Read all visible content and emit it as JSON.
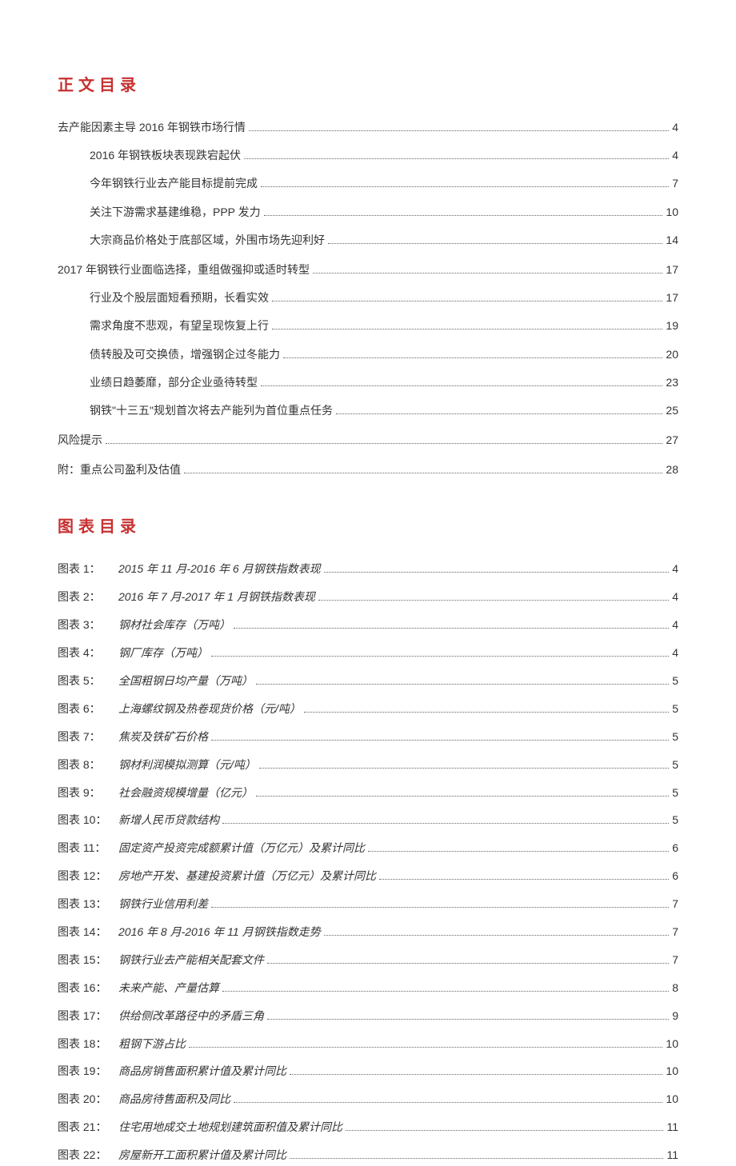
{
  "headings": {
    "toc": "正文目录",
    "figures": "图表目录"
  },
  "toc": [
    {
      "level": 1,
      "text": "去产能因素主导 2016 年钢铁市场行情",
      "page": "4"
    },
    {
      "level": 2,
      "text": "2016 年钢铁板块表现跌宕起伏",
      "page": "4"
    },
    {
      "level": 2,
      "text": "今年钢铁行业去产能目标提前完成",
      "page": "7"
    },
    {
      "level": 2,
      "text": "关注下游需求基建维稳，PPP 发力",
      "page": "10"
    },
    {
      "level": 2,
      "text": "大宗商品价格处于底部区域，外围市场先迎利好",
      "page": "14"
    },
    {
      "level": 1,
      "text": "2017 年钢铁行业面临选择，重组做强抑或适时转型",
      "page": "17"
    },
    {
      "level": 2,
      "text": "行业及个股层面短看预期，长看实效",
      "page": "17"
    },
    {
      "level": 2,
      "text": "需求角度不悲观，有望呈现恢复上行",
      "page": "19"
    },
    {
      "level": 2,
      "text": "债转股及可交换债，增强钢企过冬能力",
      "page": "20"
    },
    {
      "level": 2,
      "text": "业绩日趋萎靡，部分企业亟待转型",
      "page": "23"
    },
    {
      "level": 2,
      "text": "钢铁\"十三五\"规划首次将去产能列为首位重点任务",
      "page": "25"
    },
    {
      "level": 1,
      "text": "风险提示",
      "page": "27"
    },
    {
      "level": 1,
      "text": "附：重点公司盈利及估值",
      "page": "28"
    }
  ],
  "figures": [
    {
      "label": "图表 1：",
      "title": "2015 年 11 月-2016 年 6 月钢铁指数表现",
      "page": "4"
    },
    {
      "label": "图表 2：",
      "title": "2016 年 7 月-2017 年 1 月钢铁指数表现",
      "page": "4"
    },
    {
      "label": "图表 3：",
      "title": "钢材社会库存（万吨）",
      "page": "4"
    },
    {
      "label": "图表 4：",
      "title": "钢厂库存（万吨）",
      "page": "4"
    },
    {
      "label": "图表 5：",
      "title": "全国粗钢日均产量（万吨）",
      "page": "5"
    },
    {
      "label": "图表 6：",
      "title": "上海螺纹钢及热卷现货价格（元/吨）",
      "page": "5"
    },
    {
      "label": "图表 7：",
      "title": "焦炭及铁矿石价格",
      "page": "5"
    },
    {
      "label": "图表 8：",
      "title": "钢材利润模拟测算（元/吨）",
      "page": "5"
    },
    {
      "label": "图表 9：",
      "title": "社会融资规模增量（亿元）",
      "page": "5"
    },
    {
      "label": "图表 10：",
      "title": "新增人民币贷款结构",
      "page": "5"
    },
    {
      "label": "图表 11：",
      "title": "固定资产投资完成额累计值（万亿元）及累计同比",
      "page": "6"
    },
    {
      "label": "图表 12：",
      "title": "房地产开发、基建投资累计值（万亿元）及累计同比",
      "page": "6"
    },
    {
      "label": "图表 13：",
      "title": "钢铁行业信用利差",
      "page": "7"
    },
    {
      "label": "图表 14：",
      "title": "2016 年 8 月-2016 年 11 月钢铁指数走势",
      "page": "7"
    },
    {
      "label": "图表 15：",
      "title": "钢铁行业去产能相关配套文件",
      "page": "7"
    },
    {
      "label": "图表 16：",
      "title": "未来产能、产量估算",
      "page": "8"
    },
    {
      "label": "图表 17：",
      "title": "供给侧改革路径中的矛盾三角",
      "page": "9"
    },
    {
      "label": "图表 18：",
      "title": "粗钢下游占比",
      "page": "10"
    },
    {
      "label": "图表 19：",
      "title": "商品房销售面积累计值及累计同比",
      "page": "10"
    },
    {
      "label": "图表 20：",
      "title": "商品房待售面积及同比",
      "page": "10"
    },
    {
      "label": "图表 21：",
      "title": "住宅用地成交土地规划建筑面积值及累计同比",
      "page": "11"
    },
    {
      "label": "图表 22：",
      "title": "房屋新开工面积累计值及累计同比",
      "page": "11"
    }
  ]
}
